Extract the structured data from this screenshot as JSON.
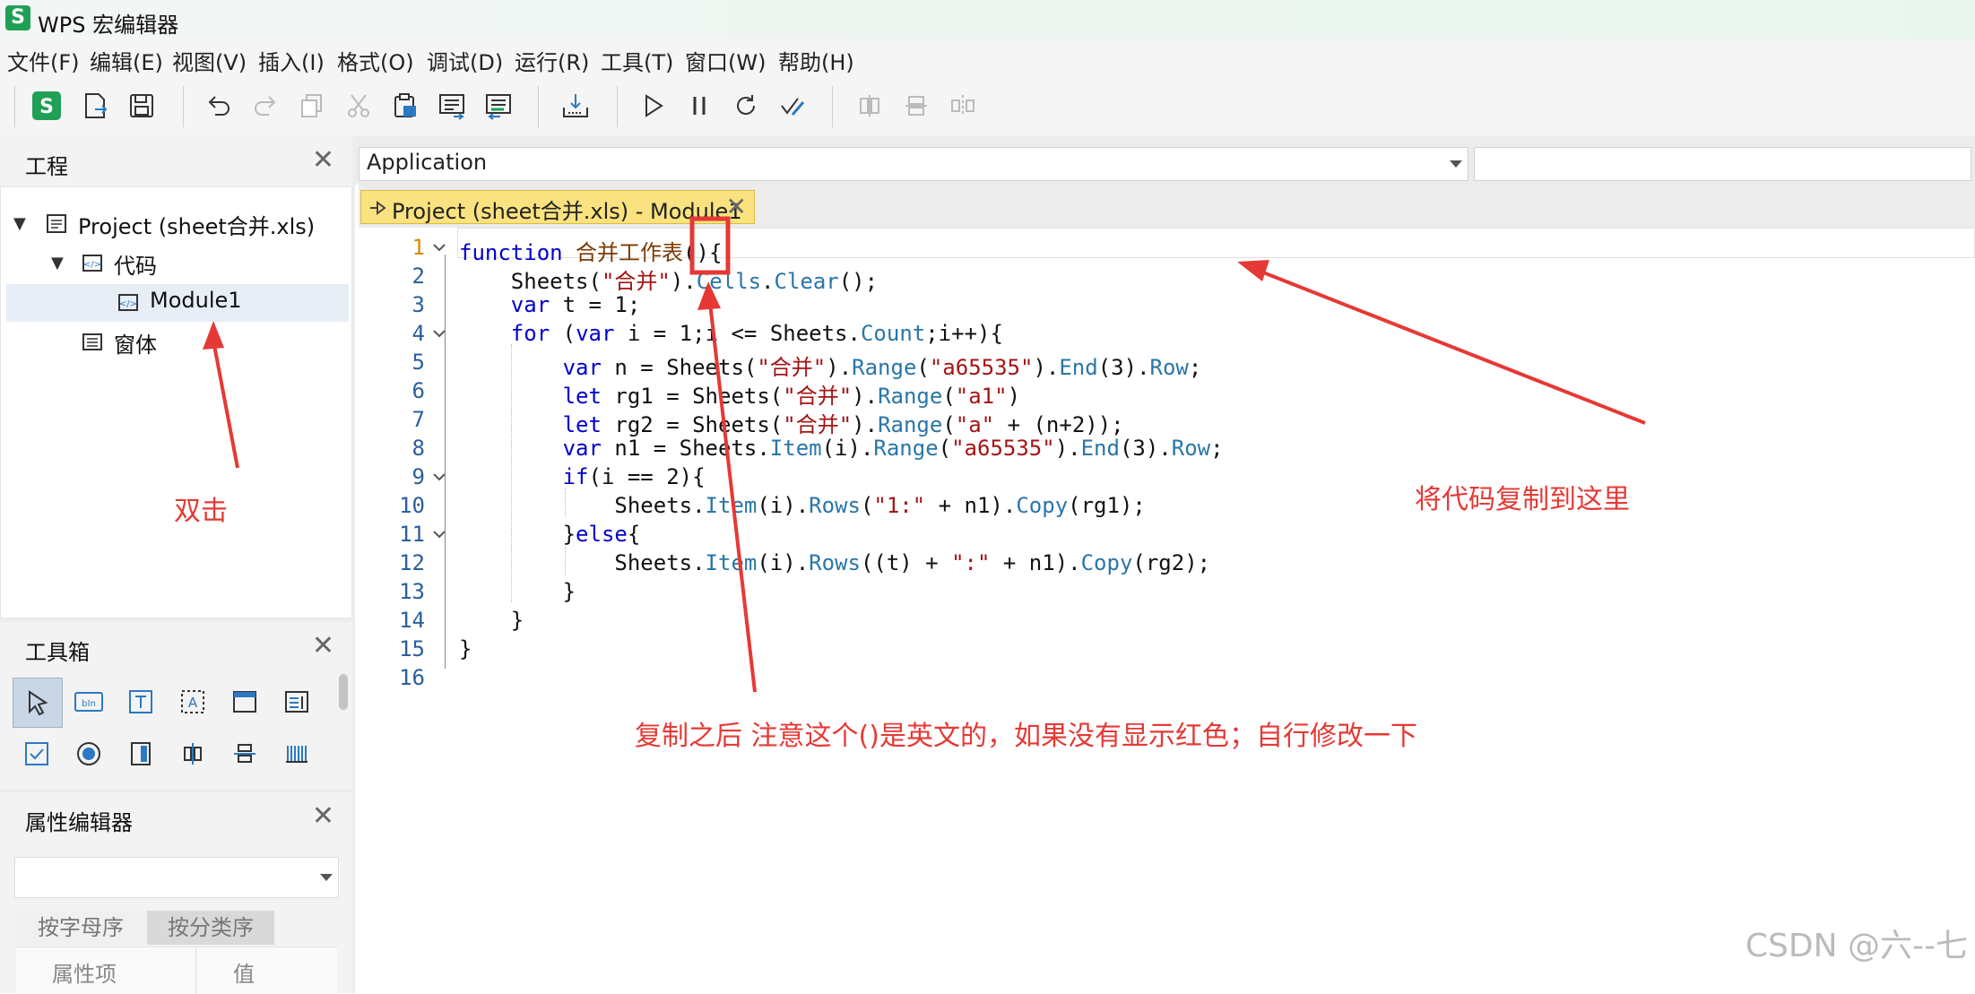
{
  "window": {
    "app_icon_letter": "S",
    "title": "WPS 宏编辑器"
  },
  "menu": [
    "文件(F)",
    "编辑(E)",
    "视图(V)",
    "插入(I)",
    "格式(O)",
    "调试(D)",
    "运行(R)",
    "工具(T)",
    "窗口(W)",
    "帮助(H)"
  ],
  "toolbar": {
    "buttons": [
      {
        "name": "wps-logo-icon",
        "enabled": true
      },
      {
        "name": "export-icon",
        "enabled": true
      },
      {
        "name": "save-icon",
        "enabled": true
      },
      {
        "name": "undo-icon",
        "enabled": true
      },
      {
        "name": "redo-icon",
        "enabled": false
      },
      {
        "name": "copy-icon",
        "enabled": false
      },
      {
        "name": "cut-icon",
        "enabled": false
      },
      {
        "name": "paste-icon",
        "enabled": true
      },
      {
        "name": "indent-icon",
        "enabled": true
      },
      {
        "name": "outdent-icon",
        "enabled": true
      },
      {
        "name": "import-icon",
        "enabled": true
      },
      {
        "name": "run-icon",
        "enabled": true
      },
      {
        "name": "pause-icon",
        "enabled": true
      },
      {
        "name": "reset-icon",
        "enabled": true
      },
      {
        "name": "design-mode-icon",
        "enabled": true
      },
      {
        "name": "align-center-h-icon",
        "enabled": false
      },
      {
        "name": "align-center-v-icon",
        "enabled": false
      },
      {
        "name": "distribute-icon",
        "enabled": false
      }
    ]
  },
  "project_panel": {
    "title": "工程",
    "close": "✕",
    "tree": [
      {
        "label": "Project (sheet合并.xls)",
        "icon": "project-icon"
      },
      {
        "label": "代码",
        "icon": "code-folder-icon"
      },
      {
        "label": "Module1",
        "icon": "module-icon",
        "selected": true
      },
      {
        "label": "窗体",
        "icon": "form-folder-icon"
      }
    ]
  },
  "toolbox_panel": {
    "title": "工具箱",
    "close": "✕",
    "tools": [
      "pointer-icon",
      "button-icon",
      "label-icon",
      "text-field-icon",
      "frame-icon",
      "listbox-icon",
      "checkbox-icon",
      "radio-icon",
      "scrollbar-icon",
      "spin-h-icon",
      "spin-v-icon",
      "image-icon"
    ]
  },
  "property_panel": {
    "title": "属性编辑器",
    "close": "✕",
    "select_value": "",
    "tabs": [
      "按字母序",
      "按分类序"
    ],
    "columns": [
      "属性项",
      "值"
    ]
  },
  "object_combo": {
    "value": "Application"
  },
  "proc_combo": {
    "value": ""
  },
  "editor_tab": {
    "label": "Project (sheet合并.xls) - Module1",
    "close": "✕"
  },
  "code": {
    "line_numbers": [
      "1",
      "2",
      "3",
      "4",
      "5",
      "6",
      "7",
      "8",
      "9",
      "10",
      "11",
      "12",
      "13",
      "14",
      "15",
      "16"
    ],
    "lines": [
      "function 合并工作表(){",
      "    Sheets(\"合并\").Cells.Clear();",
      "    var t = 1;",
      "    for (var i = 1;i <= Sheets.Count;i++){",
      "        var n = Sheets(\"合并\").Range(\"a65535\").End(3).Row;",
      "        let rg1 = Sheets(\"合并\").Range(\"a1\")",
      "        let rg2 = Sheets(\"合并\").Range(\"a\" + (n+2));",
      "        var n1 = Sheets.Item(i).Range(\"a65535\").End(3).Row;",
      "        if(i == 2){",
      "            Sheets.Item(i).Rows(\"1:\" + n1).Copy(rg1);",
      "        }else{",
      "            Sheets.Item(i).Rows((t) + \":\" + n1).Copy(rg2);",
      "        }",
      "    }",
      "}",
      ""
    ]
  },
  "annotations": {
    "double_click": "双击",
    "paste_here": "将代码复制到这里",
    "note": "复制之后 注意这个()是英文的，如果没有显示红色；自行修改一下"
  },
  "watermark": "CSDN @六--七",
  "colors": {
    "accent_red": "#e53935",
    "brand_green": "#1fa055",
    "tab_yellow": "#f9e27f"
  }
}
